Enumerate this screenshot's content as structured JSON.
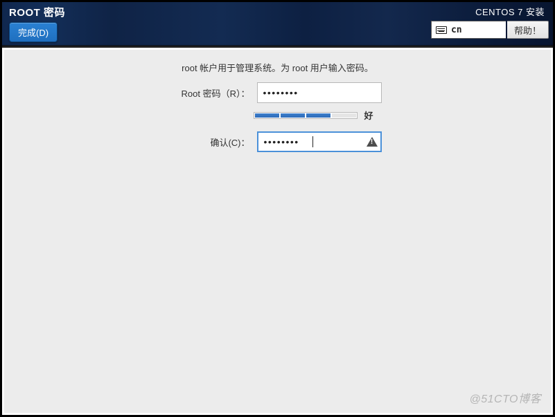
{
  "header": {
    "page_title": "ROOT 密码",
    "done_label": "完成(D)",
    "installer_title": "CENTOS 7 安装",
    "keyboard_layout": "cn",
    "help_label": "帮助！"
  },
  "form": {
    "description": "root 帐户用于管理系统。为 root 用户输入密码。",
    "password_label": "Root 密码（R）：",
    "confirm_label": "确认(C)：",
    "password_value": "••••••••",
    "confirm_value": "••••••••",
    "strength_label": "好",
    "strength_segments": [
      true,
      true,
      true,
      false
    ]
  },
  "watermark": "@51CTO博客"
}
